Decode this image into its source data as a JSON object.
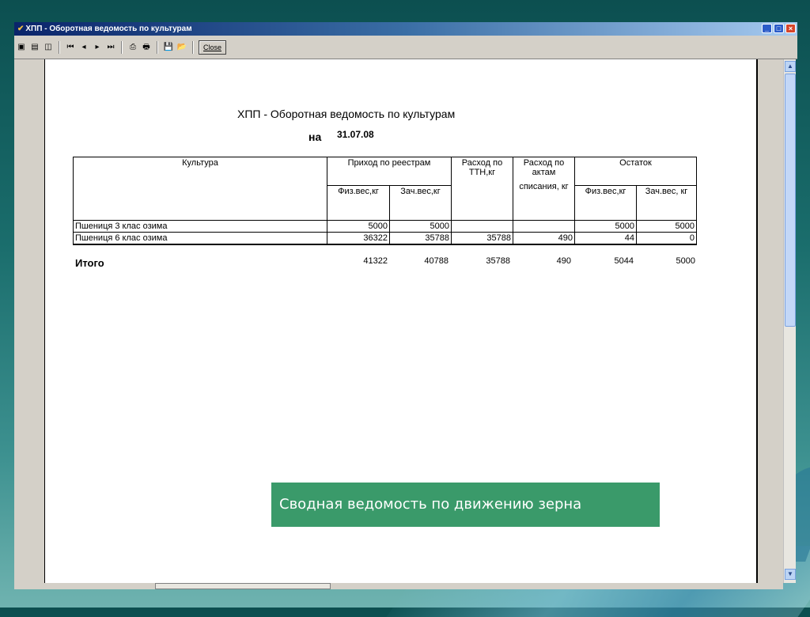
{
  "window": {
    "title": "ХПП - Оборотная ведомость по культурам",
    "minimize_glyph": "_",
    "maximize_glyph": "□",
    "close_glyph": "×"
  },
  "toolbar": {
    "close_label": "Close",
    "icons": [
      "page-single-icon",
      "page-list-icon",
      "page-zoom-icon",
      "first-page-icon",
      "prev-page-icon",
      "next-page-icon",
      "last-page-icon",
      "printer-setup-icon",
      "print-icon",
      "save-icon",
      "open-icon"
    ]
  },
  "report": {
    "title": "ХПП - Оборотная ведомость по культурам",
    "date_label": "на",
    "date": "31.07.08",
    "headers": {
      "culture": "Культура",
      "income": "Приход по реестрам",
      "income_phys": "Физ.вес,кг",
      "income_credit": "Зач.вес,кг",
      "expense_ttn": "Расход по ТТН,кг",
      "expense_act_1": "Расход по актам",
      "expense_act_2": "списания, кг",
      "balance": "Остаток",
      "balance_phys": "Физ.вес,кг",
      "balance_credit": "Зач.вес, кг"
    },
    "rows": [
      {
        "culture": "Пшениця 3 клас озима",
        "income_phys": "5000",
        "income_credit": "5000",
        "expense_ttn": "",
        "expense_act": "",
        "balance_phys": "5000",
        "balance_credit": "5000"
      },
      {
        "culture": "Пшениця 6 клас озима",
        "income_phys": "36322",
        "income_credit": "35788",
        "expense_ttn": "35788",
        "expense_act": "490",
        "balance_phys": "44",
        "balance_credit": "0"
      }
    ],
    "totals": {
      "label": "Итого",
      "income_phys": "41322",
      "income_credit": "40788",
      "expense_ttn": "35788",
      "expense_act": "490",
      "balance_phys": "5044",
      "balance_credit": "5000"
    }
  },
  "caption": "Сводная ведомость по движению зерна",
  "scrollbar": {
    "up_glyph": "▲",
    "down_glyph": "▼"
  },
  "colors": {
    "caption_bg": "#3a9a6a",
    "titlebar_start": "#0a246a"
  }
}
